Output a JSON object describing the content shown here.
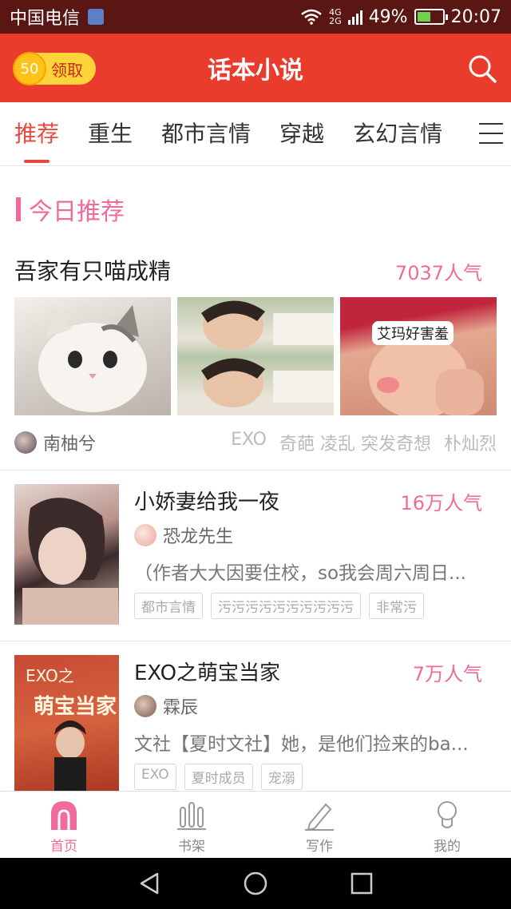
{
  "status_bar": {
    "carrier": "中国电信",
    "network_top": "4G",
    "network_bottom": "2G",
    "battery": "49%",
    "time": "20:07"
  },
  "header": {
    "coin_value": "50",
    "coin_label": "领取",
    "title": "话本小说"
  },
  "tabs": [
    {
      "label": "推荐",
      "active": true
    },
    {
      "label": "重生"
    },
    {
      "label": "都市言情"
    },
    {
      "label": "穿越"
    },
    {
      "label": "玄幻言情"
    }
  ],
  "section": {
    "title": "今日推荐"
  },
  "featured": {
    "title": "吾家有只喵成精",
    "popularity": "7037人气",
    "meme_text": "艾玛好害羞",
    "author": "南柚兮",
    "tags": [
      "EXO",
      "奇葩 凌乱 突发奇想",
      "朴灿烈"
    ]
  },
  "books": [
    {
      "title": "小娇妻给我一夜",
      "popularity": "16万人气",
      "author": "恐龙先生",
      "description": "（作者大大因要住校，so我会周六周日...",
      "tags": [
        "都市言情",
        "污污污污污污污污污污",
        "非常污"
      ]
    },
    {
      "title": "EXO之萌宝当家",
      "popularity": "7万人气",
      "author": "霖辰",
      "description": "文社【夏时文社】她，是他们捡来的ba...",
      "cover_text_top": "EXO之",
      "cover_text_main": "萌宝当家",
      "tags": [
        "EXO",
        "夏时成员",
        "宠溺"
      ]
    }
  ],
  "bottom_nav": [
    {
      "label": "首页",
      "icon": "home-icon",
      "active": true
    },
    {
      "label": "书架",
      "icon": "bookshelf-icon"
    },
    {
      "label": "写作",
      "icon": "pen-icon"
    },
    {
      "label": "我的",
      "icon": "profile-icon"
    }
  ],
  "colors": {
    "header_red": "#ea3c2d",
    "accent_pink": "#f06a9a",
    "tab_active": "#e8493e"
  }
}
